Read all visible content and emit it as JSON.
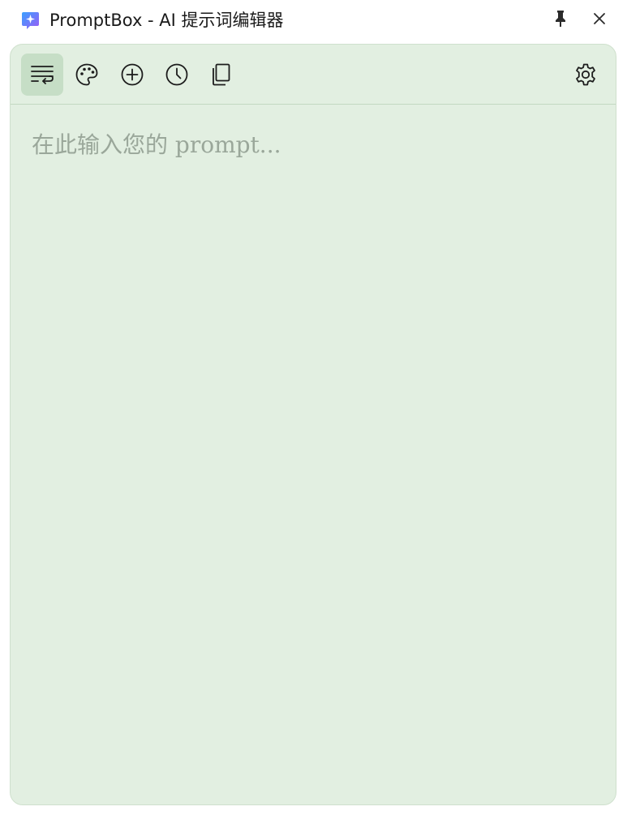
{
  "window": {
    "title": "PromptBox - AI 提示词编辑器",
    "accent_color": "#4f7df0",
    "panel_color": "#e2efe1"
  },
  "titlebar": {
    "pin_icon": "pin-icon",
    "close_icon": "close-icon"
  },
  "toolbar": {
    "tools": [
      {
        "icon": "wrap-text-icon",
        "active": true
      },
      {
        "icon": "palette-icon",
        "active": false
      },
      {
        "icon": "plus-circle-icon",
        "active": false
      },
      {
        "icon": "clock-icon",
        "active": false
      },
      {
        "icon": "copy-icon",
        "active": false
      }
    ],
    "settings_icon": "gear-icon"
  },
  "editor": {
    "value": "",
    "placeholder": "在此输入您的 prompt..."
  }
}
